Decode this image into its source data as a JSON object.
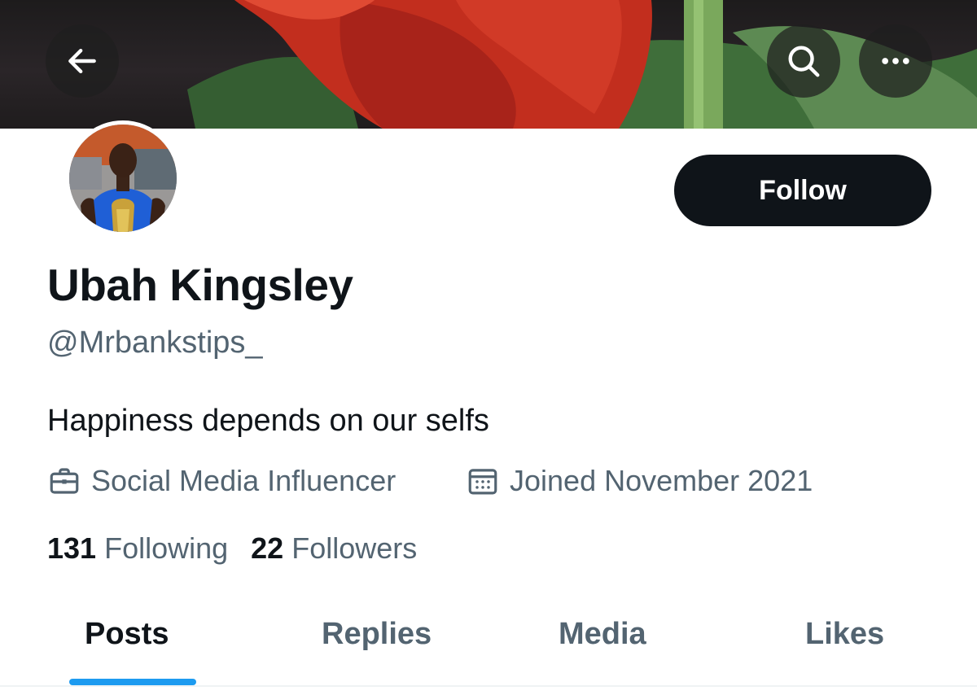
{
  "header": {
    "back_icon": "arrow-left-icon",
    "search_icon": "search-icon",
    "more_icon": "more-horizontal-icon"
  },
  "profile": {
    "name": "Ubah Kingsley",
    "handle": "@Mrbankstips_",
    "bio": "Happiness depends on our selfs",
    "profession": "Social Media Influencer",
    "joined": "Joined November 2021",
    "follow_label": "Follow"
  },
  "stats": {
    "following_count": "131",
    "following_label": "Following",
    "followers_count": "22",
    "followers_label": "Followers"
  },
  "tabs": [
    {
      "label": "Posts",
      "active": true
    },
    {
      "label": "Replies",
      "active": false
    },
    {
      "label": "Media",
      "active": false
    },
    {
      "label": "Likes",
      "active": false
    }
  ],
  "colors": {
    "accent": "#1d9bf0",
    "text_primary": "#0f1419",
    "text_secondary": "#536471"
  }
}
